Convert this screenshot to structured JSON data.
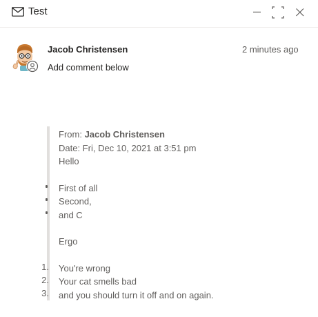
{
  "window": {
    "title": "Test",
    "icons": {
      "title": "mail-icon",
      "minimize": "minimize-icon",
      "maximize": "expand-icon",
      "close": "close-icon"
    }
  },
  "comment": {
    "author": "Jacob Christensen",
    "timestamp": "2 minutes ago",
    "text": "Add comment below"
  },
  "quoted_message": {
    "from_label": "From:",
    "from_name": "Jacob Christensen",
    "date_line": "Date: Fri, Dec 10, 2021 at 3:51 pm",
    "greeting": "Hello",
    "bullets": [
      "First of all",
      "Second,",
      "and C"
    ],
    "middle": "Ergo",
    "numbered": [
      {
        "num": "1.",
        "text": "You're wrong"
      },
      {
        "num": "2.",
        "text": "Your cat smells bad"
      },
      {
        "num": "3.",
        "text": "and you should turn it off and on again."
      }
    ]
  },
  "colors": {
    "text": "#252423",
    "secondary": "#605e5c",
    "quote_bar": "#e1dfdd",
    "divider": "#edebe9"
  }
}
